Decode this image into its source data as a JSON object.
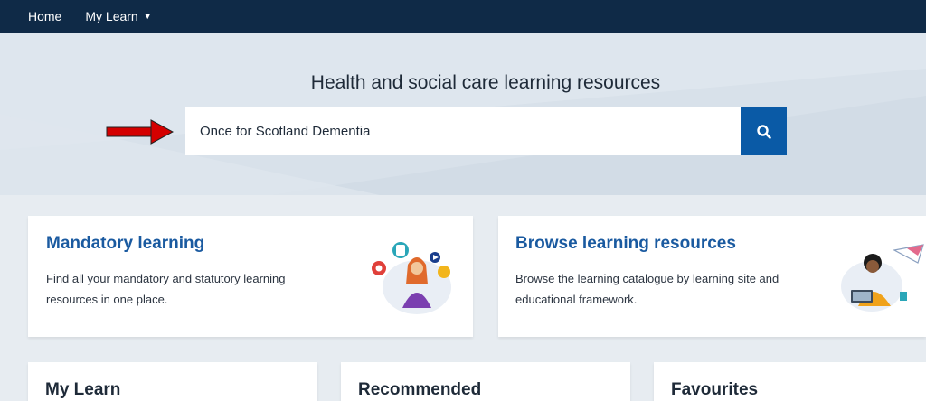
{
  "nav": {
    "home": "Home",
    "my_learn": "My Learn"
  },
  "hero": {
    "title": "Health and social care learning resources",
    "search_value": "Once for Scotland Dementia"
  },
  "cards": {
    "mandatory": {
      "title": "Mandatory learning",
      "desc_line1": "Find all your mandatory and statutory learning",
      "desc_line2": "resources in one place."
    },
    "browse": {
      "title": "Browse learning resources",
      "desc_line1": "Browse the learning catalogue by learning site and",
      "desc_line2": "educational framework."
    }
  },
  "sections": {
    "my_learn": "My Learn",
    "recommended": "Recommended",
    "favourites": "Favourites"
  },
  "colors": {
    "nav_bg": "#0f2a47",
    "hero_bg": "#d8e1ea",
    "accent": "#0a5aa6",
    "link": "#1a5aa0",
    "annotation_arrow": "#d40000"
  },
  "icons": [
    "caret-down-icon",
    "search-icon",
    "red-arrow-annotation"
  ]
}
